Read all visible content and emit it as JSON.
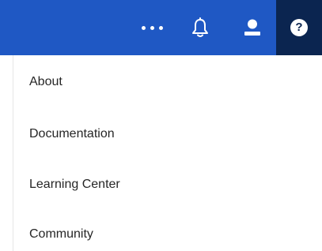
{
  "header": {
    "icons": {
      "more": "more-horizontal-icon",
      "notifications": "bell-icon",
      "user": "user-icon",
      "help": "help-icon"
    },
    "help_glyph": "?",
    "colors": {
      "bar": "#1f58c4",
      "active": "#0b2550",
      "icon": "#ffffff"
    }
  },
  "help_menu": {
    "items": [
      {
        "label": "About"
      },
      {
        "label": "Documentation"
      },
      {
        "label": "Learning Center"
      },
      {
        "label": "Community"
      }
    ]
  }
}
